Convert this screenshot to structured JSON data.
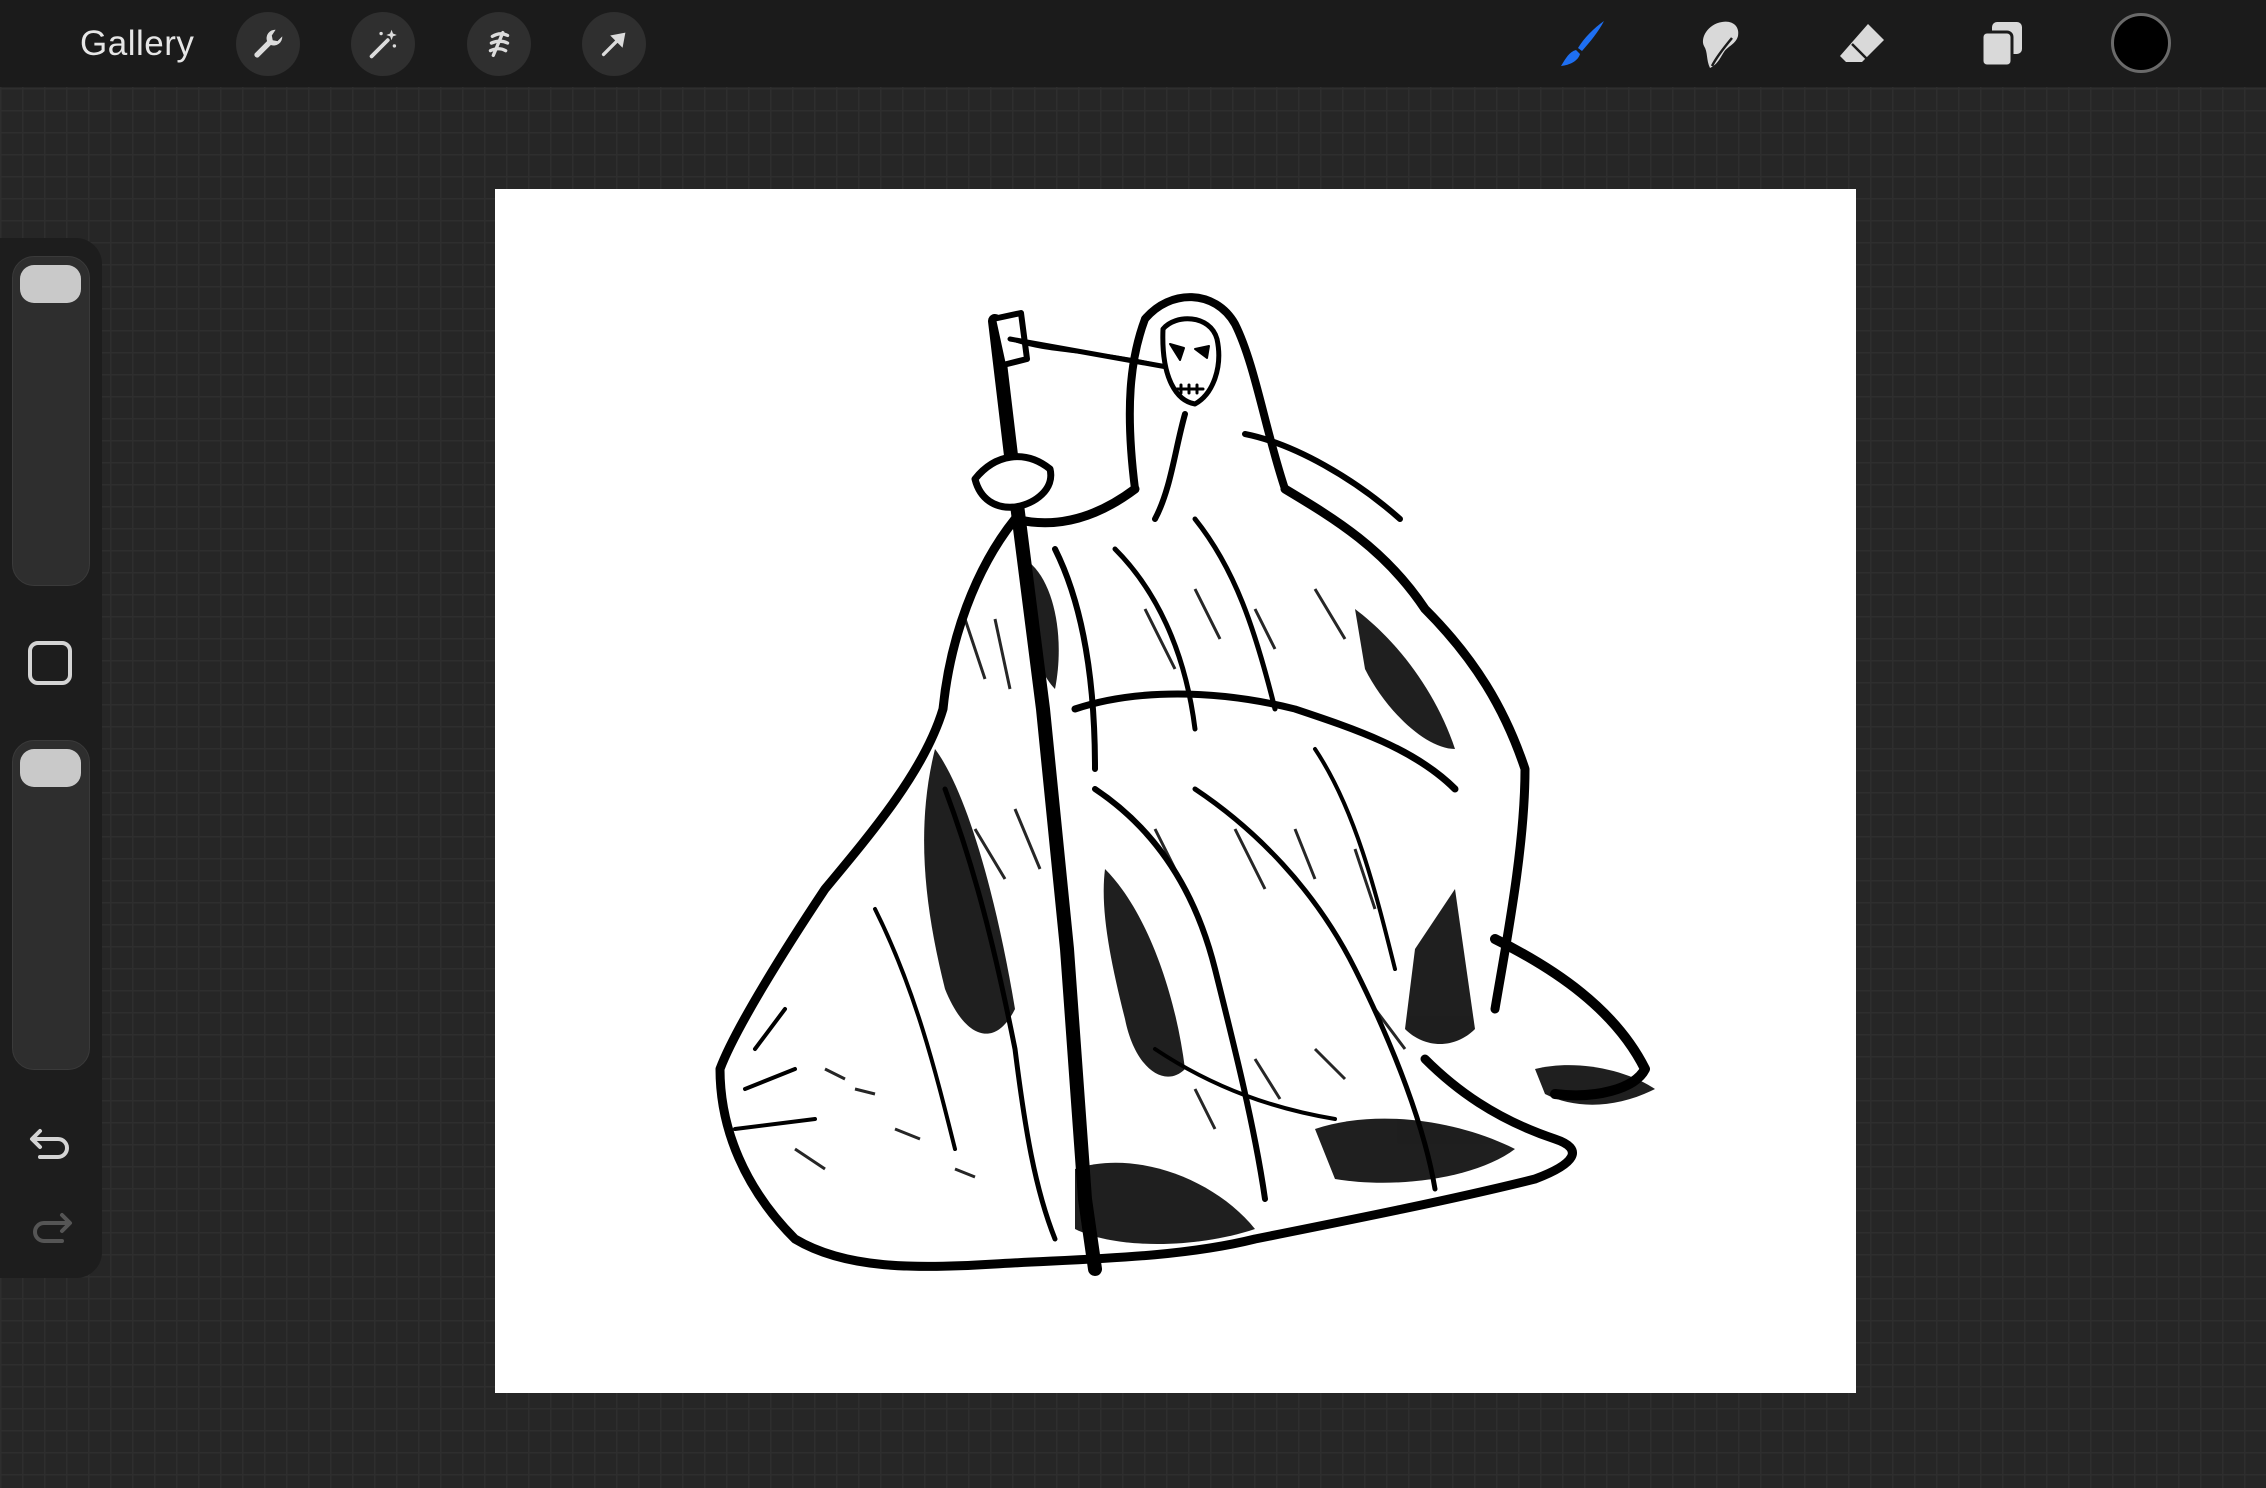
{
  "topbar": {
    "gallery_label": "Gallery",
    "left_tools": [
      "wrench-icon",
      "magic-wand-icon",
      "selection-icon",
      "transform-arrow-icon"
    ],
    "right_tools": [
      "brush-icon",
      "smudge-icon",
      "eraser-icon",
      "layers-icon"
    ],
    "active_tool": "brush",
    "active_tool_color": "#1e6ff2",
    "current_color": "#000000"
  },
  "sidebar": {
    "brush_size_slider": {
      "level": 1.0
    },
    "opacity_slider": {
      "level": 1.0
    },
    "undo_enabled": true,
    "redo_enabled": false
  },
  "canvas": {
    "background": "#ffffff",
    "artwork": "grim-reaper-ink-sketch"
  }
}
